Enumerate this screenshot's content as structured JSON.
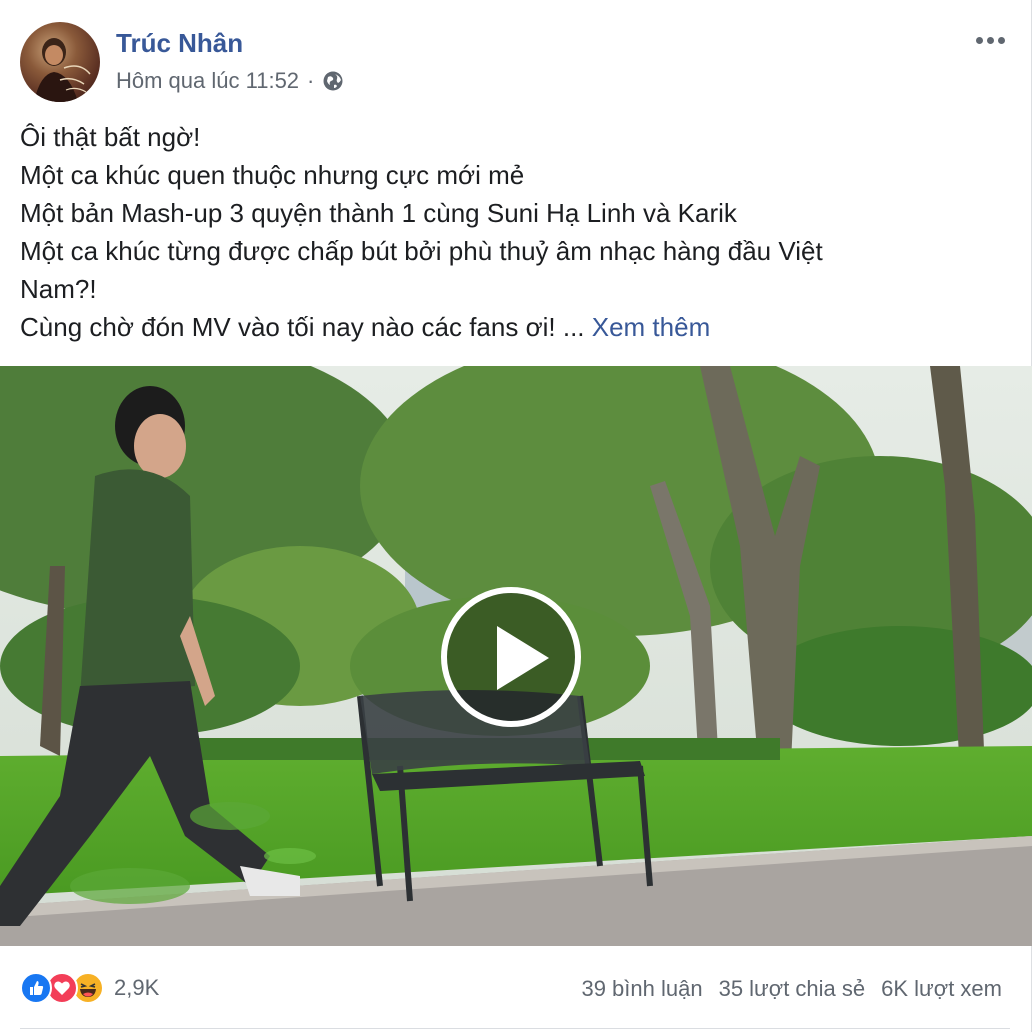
{
  "author": {
    "name": "Trúc Nhân",
    "timestamp": "Hôm qua lúc 11:52",
    "separator": "·",
    "privacy_icon": "globe-icon"
  },
  "menu_icon": "more-options-icon",
  "post": {
    "lines": [
      "Ôi thật bất ngờ!",
      "Một ca khúc quen thuộc nhưng cực mới mẻ",
      "Một bản Mash-up 3 quyện thành 1 cùng Suni Hạ Linh và Karik",
      "Một ca khúc từng được chấp bút bởi phù thuỷ âm nhạc hàng đầu Việt",
      "Nam?!"
    ],
    "last_line": "Cùng chờ đón MV vào tối nay nào các fans ơi! ...",
    "see_more": "Xem thêm"
  },
  "video": {
    "play_icon": "play-icon"
  },
  "reactions": {
    "icons": [
      "like-icon",
      "love-icon",
      "haha-icon"
    ],
    "count": "2,9K"
  },
  "stats": {
    "comments": "39 bình luận",
    "shares": "35 lượt chia sẻ",
    "views": "6K lượt xem"
  },
  "colors": {
    "link": "#385898",
    "meta": "#606770",
    "like": "#1877f2",
    "love": "#f33e58",
    "haha": "#f7b125"
  }
}
